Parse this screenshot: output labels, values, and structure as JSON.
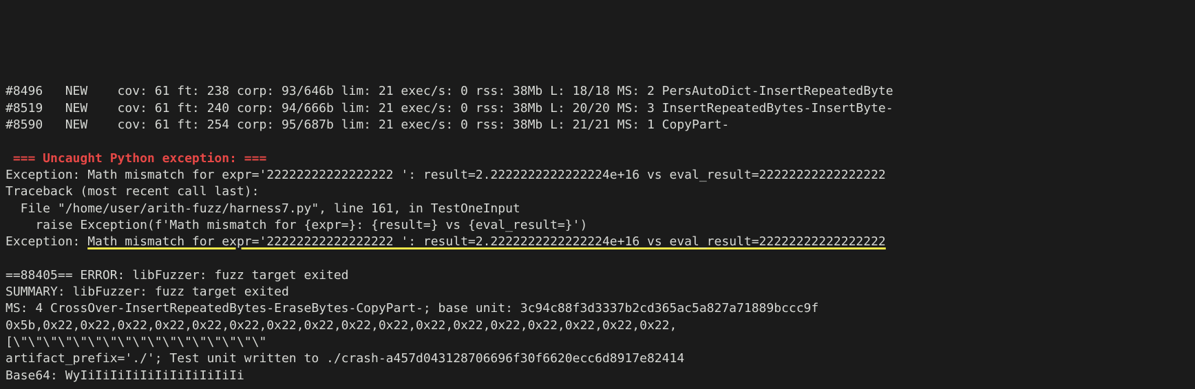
{
  "fuzz_lines": [
    "#8496\tNEW    cov: 61 ft: 238 corp: 93/646b lim: 21 exec/s: 0 rss: 38Mb L: 18/18 MS: 2 PersAutoDict-InsertRepeatedByte",
    "#8519\tNEW    cov: 61 ft: 240 corp: 94/666b lim: 21 exec/s: 0 rss: 38Mb L: 20/20 MS: 3 InsertRepeatedBytes-InsertByte-",
    "#8590\tNEW    cov: 61 ft: 254 corp: 95/687b lim: 21 exec/s: 0 rss: 38Mb L: 21/21 MS: 1 CopyPart-"
  ],
  "exception": {
    "header": " === Uncaught Python exception: ===",
    "line1": "Exception: Math mismatch for expr='22222222222222222 ': result=2.2222222222222224e+16 vs eval_result=22222222222222222",
    "traceback_intro": "Traceback (most recent call last):",
    "file_line": "  File \"/home/user/arith-fuzz/harness7.py\", line 161, in TestOneInput",
    "raise_line": "    raise Exception(f'Math mismatch for {expr=}: {result=} vs {eval_result=}')",
    "final_prefix": "Exception: ",
    "final_underlined": "Math mismatch for expr='22222222222222222 ': result=2.2222222222222224e+16 vs eval_result=22222222222222222"
  },
  "footer": [
    "==88405== ERROR: libFuzzer: fuzz target exited",
    "SUMMARY: libFuzzer: fuzz target exited",
    "MS: 4 CrossOver-InsertRepeatedBytes-EraseBytes-CopyPart-; base unit: 3c94c88f3d3337b2cd365ac5a827a71889bccc9f",
    "0x5b,0x22,0x22,0x22,0x22,0x22,0x22,0x22,0x22,0x22,0x22,0x22,0x22,0x22,0x22,0x22,0x22,0x22,",
    "[\\\"\\\"\\\"\\\"\\\"\\\"\\\"\\\"\\\"\\\"\\\"\\\"\\\"\\\"\\\"\\\"\\\"",
    "artifact_prefix='./'; Test unit written to ./crash-a457d043128706696f30f6620ecc6d8917e82414",
    "Base64: WyIiIiIiIiIiIiIiIiIiIiIi"
  ]
}
